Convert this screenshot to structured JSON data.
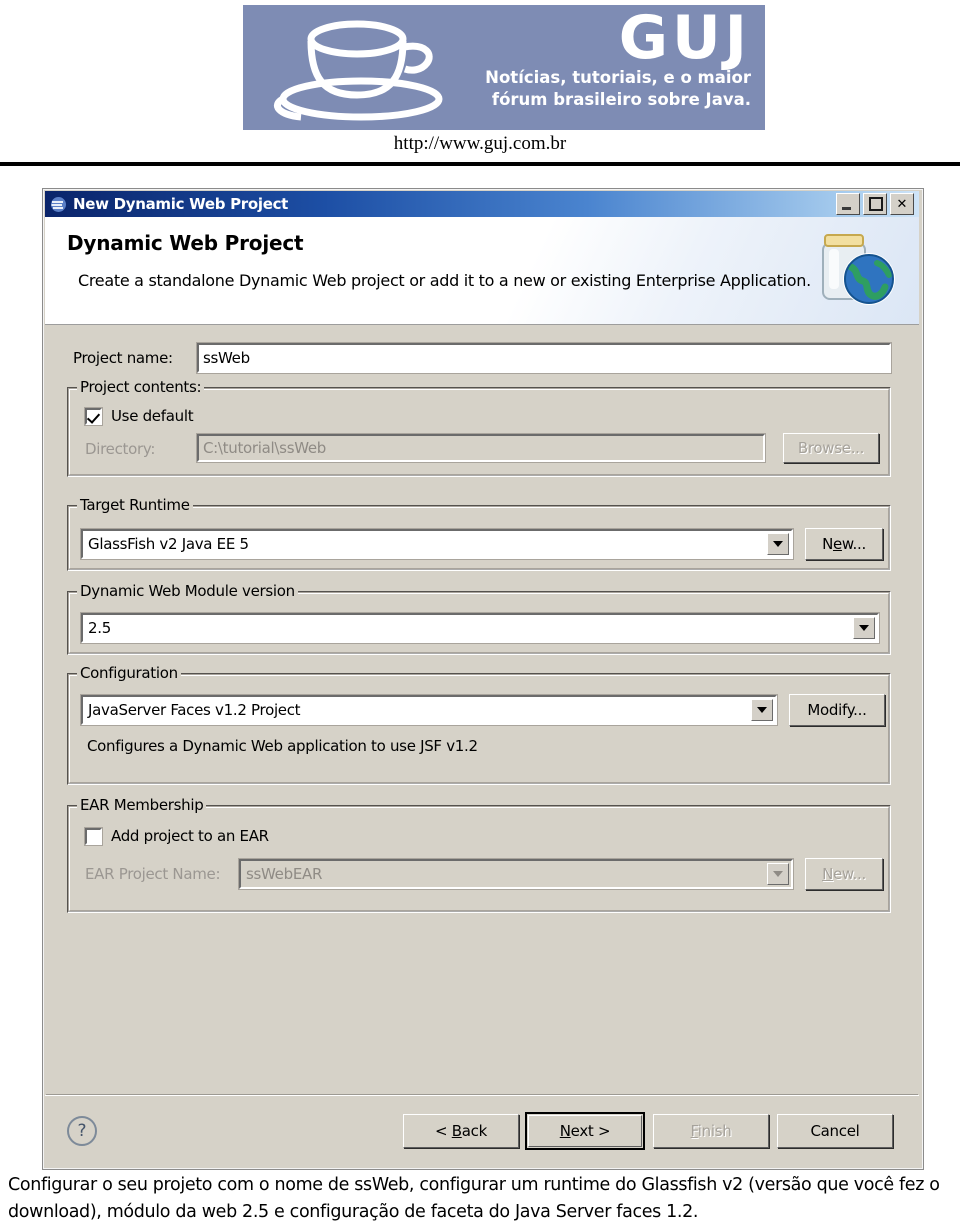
{
  "header": {
    "brand": "GUJ",
    "tagline_line1": "Notícias, tutoriais, e o maior",
    "tagline_line2": "fórum brasileiro sobre Java.",
    "url": "http://www.guj.com.br",
    "logo_icon": "coffee-cup-icon",
    "banner_color": "#7e8cb4"
  },
  "dialog": {
    "title": "New Dynamic Web Project",
    "title_icon": "eclipse-wizard-icon",
    "window_buttons": {
      "minimize": "_",
      "maximize": "□",
      "close": "X"
    },
    "banner": {
      "title": "Dynamic Web Project",
      "description": "Create a standalone Dynamic Web project or add it to a new or existing Enterprise Application.",
      "icon": "jar-globe-icon"
    },
    "project_name": {
      "label": "Project name:",
      "value": "ssWeb"
    },
    "project_contents": {
      "group_title": "Project contents:",
      "use_default_label": "Use default",
      "use_default_checked": true,
      "directory_label": "Directory:",
      "directory_value": "C:\\tutorial\\ssWeb",
      "browse_label": "Browse..."
    },
    "target_runtime": {
      "group_title": "Target Runtime",
      "value": "GlassFish v2 Java EE 5",
      "new_label": "New..."
    },
    "module_version": {
      "group_title": "Dynamic Web Module version",
      "value": "2.5"
    },
    "configuration": {
      "group_title": "Configuration",
      "value": "JavaServer Faces v1.2 Project",
      "modify_label": "Modify...",
      "description": "Configures a Dynamic Web application to use JSF v1.2"
    },
    "ear_membership": {
      "group_title": "EAR Membership",
      "add_project_label": "Add project to an EAR",
      "add_project_checked": false,
      "ear_project_label": "EAR Project Name:",
      "ear_project_value": "ssWebEAR",
      "new_label": "New..."
    },
    "footer": {
      "help_icon": "question-mark-icon",
      "back_label": "< Back",
      "next_label": "Next >",
      "finish_label": "Finish",
      "cancel_label": "Cancel",
      "finish_disabled": true,
      "default_button": "Next >"
    }
  },
  "caption": {
    "text": "Configurar o seu projeto com o nome de ssWeb, configurar um runtime do Glassfish v2 (versão que você fez o download), módulo da web 2.5 e configuração de faceta do Java Server faces 1.2."
  }
}
